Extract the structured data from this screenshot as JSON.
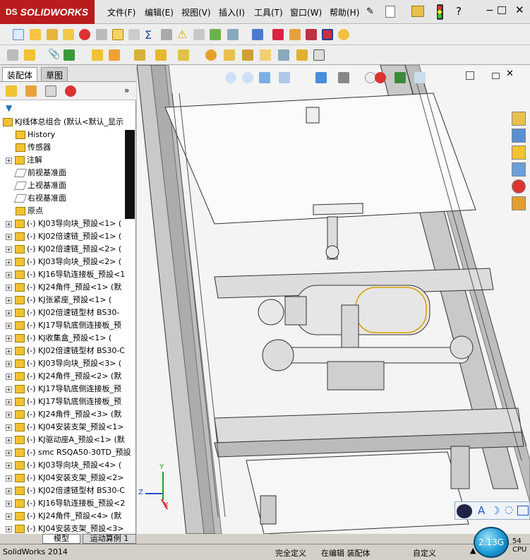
{
  "app": {
    "logo_mark": "DS",
    "logo_text": "SOLIDWORKS"
  },
  "menu": {
    "items": [
      "文件(F)",
      "编辑(E)",
      "视图(V)",
      "插入(I)",
      "工具(T)",
      "窗口(W)",
      "帮助(H)"
    ]
  },
  "feature_manager": {
    "tabs": [
      "装配体",
      "草图"
    ],
    "root": "KJ线体总组合 (默认<默认_显示",
    "fixed_items": [
      "History",
      "传感器",
      "注解",
      "前视基准面",
      "上视基准面",
      "右视基准面",
      "原点"
    ],
    "components": [
      "(-) KJ03导向块_预設<1> (",
      "(-) KJ02倍速链_预設<1> (",
      "(-) KJ02倍速链_预設<2> (",
      "(-) KJ03导向块_预設<2> (",
      "(-) KJ16导轨连接板_预設<1",
      "(-) KJ24角件_预設<1> (默",
      "(-) KJ张紧座_预設<1> (",
      "(-) KJ02倍速链型材 BS30-",
      "(-) KJ17导轨底侧连接板_预",
      "(-) KJ收集盒_预設<1> (",
      "(-) KJ02倍速链型材 BS30-C",
      "(-) KJ03导向块_预設<3> (",
      "(-) KJ24角件_预設<2> (默",
      "(-) KJ17导轨底侧连接板_预",
      "(-) KJ17导轨底侧连接板_预",
      "(-) KJ24角件_预設<3> (默",
      "(-) KJ04安装支架_预設<1>",
      "(-) KJ驱动座A_预設<1> (默",
      "(-) smc RSQA50-30TD_预設",
      "(-) KJ03导向块_预設<4> (",
      "(-) KJ04安装支架_预設<2>",
      "(-) KJ02倍速链型材 BS30-C",
      "(-) KJ16导轨连接板_预設<2",
      "(-) KJ24角件_预設<4> (默",
      "(-) KJ04安装支架_预設<3>"
    ]
  },
  "bottom_tabs": [
    "模型",
    "运动算例 1"
  ],
  "status": {
    "app": "SolidWorks 2014",
    "fully_defined": "完全定义",
    "editing": "在编辑 装配体",
    "custom": "自定义",
    "memory": "2.13G",
    "cpu": "CPU",
    "pct": "54"
  },
  "triad": {
    "z": "Z",
    "y": "Y",
    "x": "X"
  },
  "colors": {
    "brand_red": "#b91c1c",
    "accent_blue": "#2a6fb8"
  }
}
